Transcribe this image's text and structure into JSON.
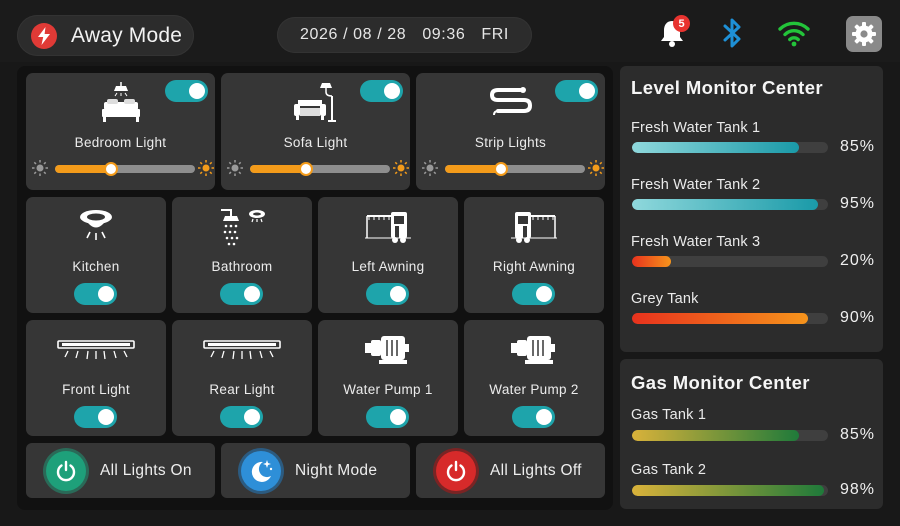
{
  "header": {
    "mode_label": "Away Mode",
    "mode_icon": "lightning-icon",
    "date": "2026 / 08 / 28",
    "time": "09:36",
    "weekday": "FRI",
    "notification_count": "5",
    "icons": [
      "bell-icon",
      "bluetooth-icon",
      "wifi-icon",
      "gear-icon"
    ],
    "colors": {
      "alert": "#e8332f",
      "bluetooth": "#1e90d6",
      "wifi": "#23c43a",
      "accent": "#1ea4ab"
    }
  },
  "dimmers": [
    {
      "label": "Bedroom Light",
      "icon": "bed-lamp-icon",
      "on": true,
      "brightness": 0.4
    },
    {
      "label": "Sofa Light",
      "icon": "sofa-lamp-icon",
      "on": true,
      "brightness": 0.4
    },
    {
      "label": "Strip Lights",
      "icon": "strip-light-icon",
      "on": true,
      "brightness": 0.4
    }
  ],
  "switches": [
    {
      "label": "Kitchen",
      "icon": "ceiling-light-icon",
      "on": true
    },
    {
      "label": "Bathroom",
      "icon": "shower-icon",
      "on": true
    },
    {
      "label": "Left Awning",
      "icon": "awning-left-icon",
      "on": true
    },
    {
      "label": "Right Awning",
      "icon": "awning-right-icon",
      "on": true
    },
    {
      "label": "Front Light",
      "icon": "light-bar-icon",
      "on": true
    },
    {
      "label": "Rear Light",
      "icon": "light-bar-icon",
      "on": true
    },
    {
      "label": "Water Pump 1",
      "icon": "pump-icon",
      "on": true
    },
    {
      "label": "Water Pump 2",
      "icon": "pump-icon",
      "on": true
    }
  ],
  "actions": [
    {
      "label": "All Lights On",
      "icon": "power-icon",
      "color": "#1ea07a"
    },
    {
      "label": "Night Mode",
      "icon": "moon-stars-icon",
      "color": "#2e8fd8"
    },
    {
      "label": "All Lights Off",
      "icon": "power-icon",
      "color": "#d72a2a"
    }
  ],
  "level_monitor": {
    "title": "Level Monitor Center",
    "tanks": [
      {
        "name": "Fresh Water Tank 1",
        "value": "85%",
        "level": 0.85,
        "colors": [
          "#8fd8dc",
          "#1a9aa8"
        ]
      },
      {
        "name": "Fresh Water Tank 2",
        "value": "95%",
        "level": 0.95,
        "colors": [
          "#8fd8dc",
          "#1a9aa8"
        ]
      },
      {
        "name": "Fresh Water Tank 3",
        "value": "20%",
        "level": 0.2,
        "colors": [
          "#e8321d",
          "#f5941c"
        ]
      },
      {
        "name": "Grey Tank",
        "value": "90%",
        "level": 0.9,
        "colors": [
          "#e8321d",
          "#f5941c"
        ]
      }
    ]
  },
  "gas_monitor": {
    "title": "Gas Monitor Center",
    "tanks": [
      {
        "name": "Gas Tank 1",
        "value": "85%",
        "level": 0.85,
        "colors": [
          "#d9b23a",
          "#1f7a3a"
        ]
      },
      {
        "name": "Gas Tank 2",
        "value": "98%",
        "level": 0.98,
        "colors": [
          "#d9b23a",
          "#1f7a3a"
        ]
      }
    ]
  }
}
